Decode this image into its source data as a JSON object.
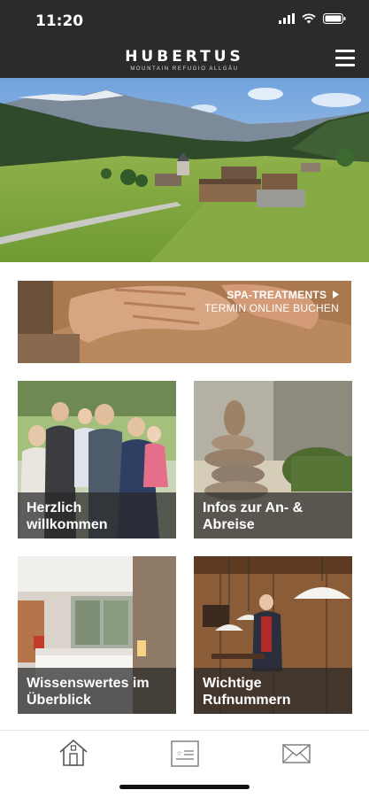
{
  "status_bar": {
    "time": "11:20"
  },
  "header": {
    "logo_title": "HUBERTUS",
    "logo_subtitle": "MOUNTAIN REFUGIO ALLGÄU",
    "menu_icon": "hamburger-icon"
  },
  "banner": {
    "title": "SPA-TREATMENTS",
    "subtitle": "TERMIN ONLINE BUCHEN",
    "arrow_icon": "triangle-right-icon"
  },
  "tiles": [
    {
      "line1": "Herzlich",
      "line2": "willkommen"
    },
    {
      "line1": "Infos zur An- &",
      "line2": "Abreise"
    },
    {
      "line1": "Wissenswertes im",
      "line2": "Überblick"
    },
    {
      "line1": "Wichtige",
      "line2": "Rufnummern"
    }
  ],
  "bottom_nav": [
    {
      "icon": "home-icon"
    },
    {
      "icon": "id-card-icon"
    },
    {
      "icon": "mail-icon"
    }
  ]
}
